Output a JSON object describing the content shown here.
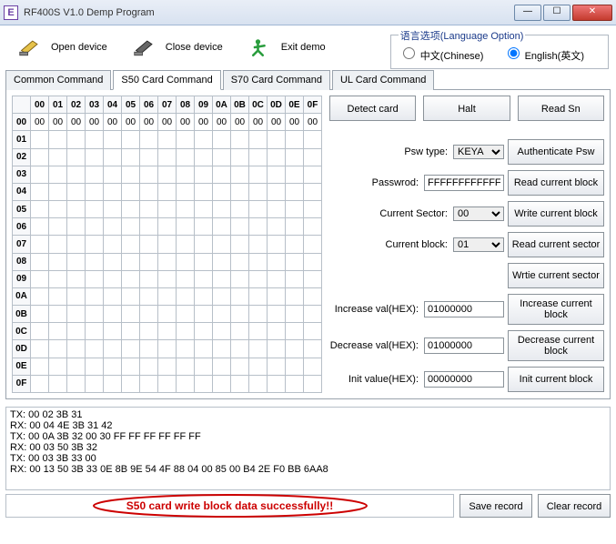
{
  "window": {
    "icon_letter": "E",
    "title": "RF400S V1.0 Demp Program"
  },
  "toolbar": {
    "open": "Open device",
    "close": "Close device",
    "exit": "Exit demo"
  },
  "lang": {
    "legend": "语言选项(Language Option)",
    "chinese": "中文(Chinese)",
    "english": "English(英文)",
    "selected": "english"
  },
  "tabs": {
    "common": "Common Command",
    "s50": "S50 Card Command",
    "s70": "S70 Card Command",
    "ul": "UL Card Command",
    "active": "s50"
  },
  "hex": {
    "cols": [
      "00",
      "01",
      "02",
      "03",
      "04",
      "05",
      "06",
      "07",
      "08",
      "09",
      "0A",
      "0B",
      "0C",
      "0D",
      "0E",
      "0F"
    ],
    "rows": [
      "00",
      "01",
      "02",
      "03",
      "04",
      "05",
      "06",
      "07",
      "08",
      "09",
      "0A",
      "0B",
      "0C",
      "0D",
      "0E",
      "0F"
    ],
    "row00": [
      "00",
      "00",
      "00",
      "00",
      "00",
      "00",
      "00",
      "00",
      "00",
      "00",
      "00",
      "00",
      "00",
      "00",
      "00",
      "00"
    ]
  },
  "actions": {
    "detect": "Detect card",
    "halt": "Halt",
    "readsn": "Read Sn",
    "auth": "Authenticate Psw",
    "readblock": "Read current block",
    "writeblock": "Write current block",
    "readsector": "Read current sector",
    "writesector": "Wrtie current sector",
    "incblock": "Increase current block",
    "decblock": "Decrease current block",
    "initblock": "Init current block"
  },
  "labels": {
    "pswtype": "Psw type:",
    "password": "Passwrod:",
    "cursector": "Current Sector:",
    "curblock": "Current block:",
    "incval": "Increase val(HEX):",
    "decval": "Decrease val(HEX):",
    "initval": "Init value(HEX):"
  },
  "values": {
    "pswtype": "KEYA",
    "password": "FFFFFFFFFFFF",
    "cursector": "00",
    "curblock": "01",
    "incval": "01000000",
    "decval": "01000000",
    "initval": "00000000"
  },
  "log": "TX: 00 02 3B 31\nRX: 00 04 4E 3B 31 42\nTX: 00 0A 3B 32 00 30 FF FF FF FF FF FF\nRX: 00 03 50 3B 32\nTX: 00 03 3B 33 00\nRX: 00 13 50 3B 33 0E 8B 9E 54 4F 88 04 00 85 00 B4 2E F0 BB 6AA8",
  "status_msg": "S50 card write block data successfully!!",
  "footer": {
    "save": "Save record",
    "clear": "Clear record"
  }
}
